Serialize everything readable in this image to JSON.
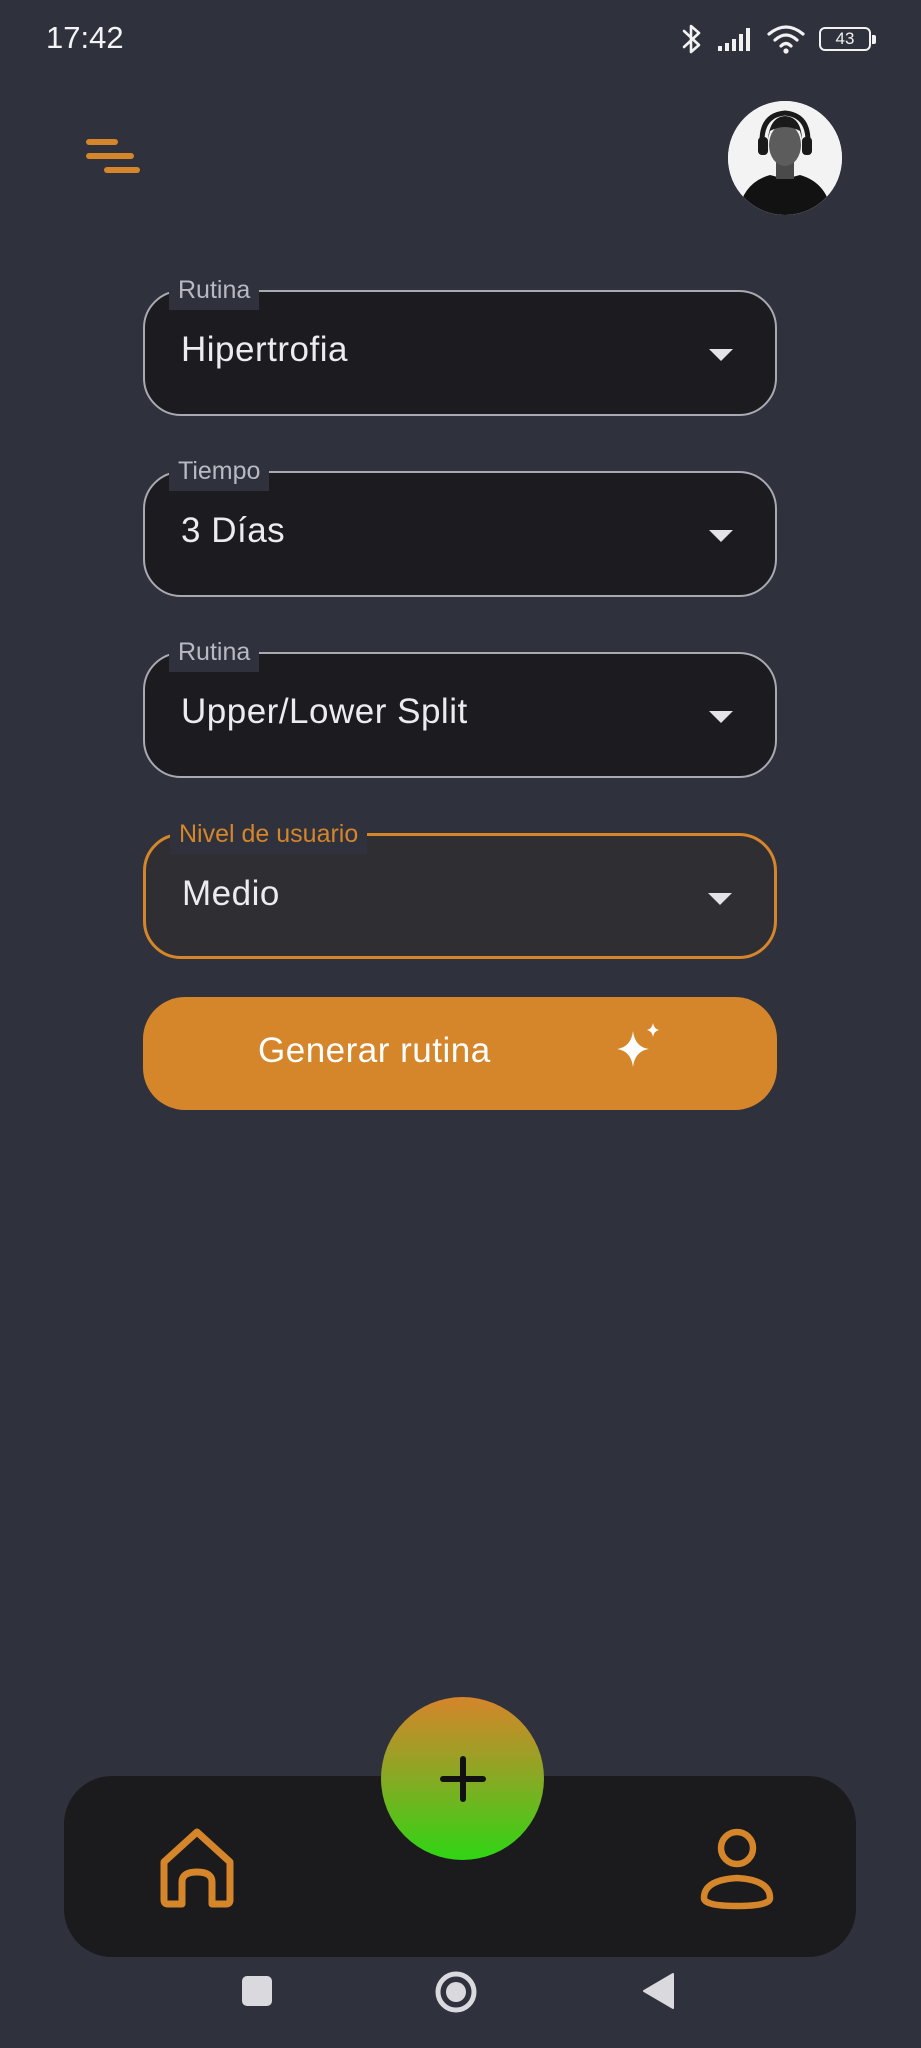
{
  "status_bar": {
    "time": "17:42",
    "battery": "43"
  },
  "fields": [
    {
      "label": "Rutina",
      "value": "Hipertrofia"
    },
    {
      "label": "Tiempo",
      "value": "3 Días"
    },
    {
      "label": "Rutina",
      "value": "Upper/Lower Split"
    },
    {
      "label": "Nivel de usuario",
      "value": "Medio",
      "focused": true
    }
  ],
  "generate_button": {
    "label": "Generar rutina"
  },
  "colors": {
    "background": "#2f313d",
    "accent": "#d5852a",
    "field_background": "#1c1c20",
    "nav_background": "#1b1b1d",
    "fab_gradient_end": "#2fd514"
  },
  "icons": {
    "menu": "menu-icon",
    "avatar": "avatar",
    "dropdown": "dropdown-arrow-icon",
    "sparkle": "sparkle-icon",
    "add": "plus-icon",
    "home": "home-icon",
    "profile": "user-icon",
    "system_recents": "square-icon",
    "system_home": "circle-icon",
    "system_back": "back-triangle-icon"
  }
}
